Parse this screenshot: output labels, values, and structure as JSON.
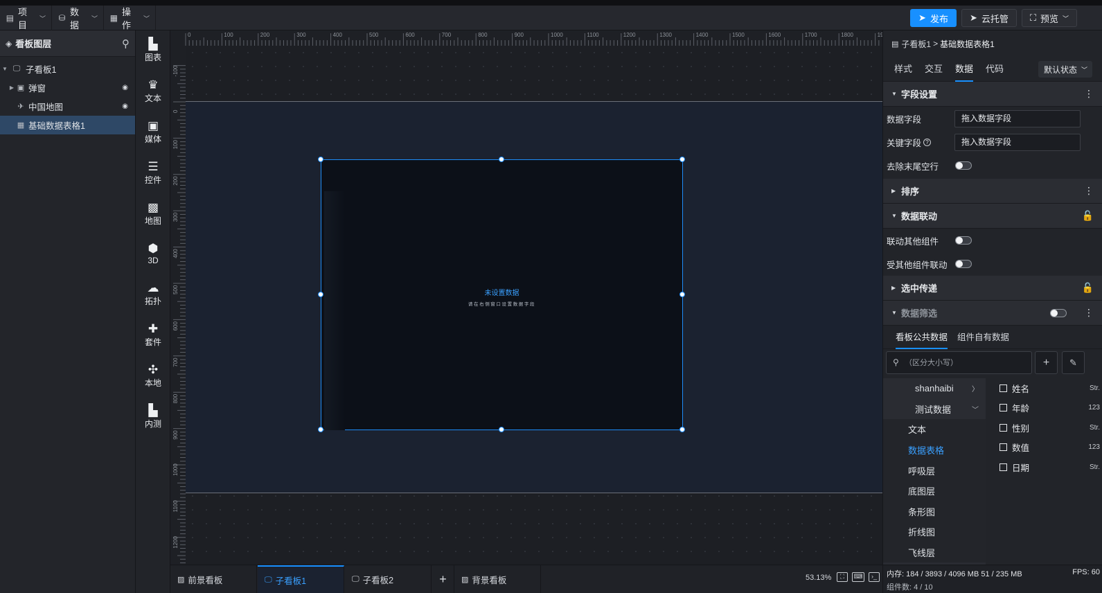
{
  "menus": [
    {
      "icon": "document-icon",
      "label": "项目"
    },
    {
      "icon": "database-icon",
      "label": "数据"
    },
    {
      "icon": "grid-icon",
      "label": "操作"
    }
  ],
  "toolbar": {
    "publish": "发布",
    "cloud": "云托管",
    "preview": "预览"
  },
  "layers": {
    "title": "看板图层",
    "items": [
      {
        "label": "子看板1"
      },
      {
        "label": "弹窗"
      },
      {
        "label": "中国地图"
      },
      {
        "label": "基础数据表格1"
      }
    ]
  },
  "components": [
    "图表",
    "文本",
    "媒体",
    "控件",
    "地图",
    "3D",
    "拓扑",
    "套件",
    "本地",
    "内测"
  ],
  "ruler": {
    "top": [
      "0",
      "100",
      "200",
      "300",
      "400",
      "500",
      "600",
      "700",
      "800",
      "900",
      "1000",
      "1100",
      "1200",
      "1300",
      "1400",
      "1500",
      "1600",
      "1700",
      "1800",
      "1900"
    ],
    "left": [
      "-100",
      "0",
      "100",
      "200",
      "300",
      "400",
      "500",
      "600",
      "700",
      "800",
      "900",
      "1000",
      "1100",
      "1200"
    ]
  },
  "canvas": {
    "empty_title": "未设置数据",
    "empty_sub": "请在右侧窗口设置数据字段"
  },
  "bottom": {
    "tabs": [
      "前景看板",
      "子看板1",
      "子看板2",
      "背景看板"
    ],
    "add": "+",
    "zoom": "53.13%"
  },
  "panel": {
    "crumb_parent": "子看板1",
    "crumb_sep": ">",
    "crumb_current": "基础数据表格1",
    "tabs": [
      "样式",
      "交互",
      "数据",
      "代码"
    ],
    "state": "默认状态",
    "sections": {
      "fields": "字段设置",
      "sort": "排序",
      "linkage": "数据联动",
      "pass": "选中传递",
      "filter": "数据筛选"
    },
    "rows": {
      "data_field": "数据字段",
      "key_field": "关键字段",
      "trim": "去除末尾空行",
      "link_other": "联动其他组件",
      "linked_by": "受其他组件联动"
    },
    "field_placeholder": "拖入数据字段",
    "source_tabs": [
      "看板公共数据",
      "组件自有数据"
    ],
    "search_placeholder": "（区分大小写）",
    "sources": [
      "shanhaibi",
      "测试数据"
    ],
    "tables": [
      "文本",
      "数据表格",
      "呼吸层",
      "底图层",
      "条形图",
      "折线图",
      "飞线层"
    ],
    "fields": [
      {
        "name": "姓名",
        "type": "Str."
      },
      {
        "name": "年龄",
        "type": "123"
      },
      {
        "name": "性别",
        "type": "Str."
      },
      {
        "name": "数值",
        "type": "123"
      },
      {
        "name": "日期",
        "type": "Str."
      }
    ],
    "status": {
      "memory": "内存: 184 / 3893 / 4096 MB  51 / 235 MB",
      "fps": "FPS: 60",
      "count": "组件数: 4 / 10"
    }
  },
  "colors": {
    "accent": "#1890ff",
    "selection": "#2e4866"
  }
}
